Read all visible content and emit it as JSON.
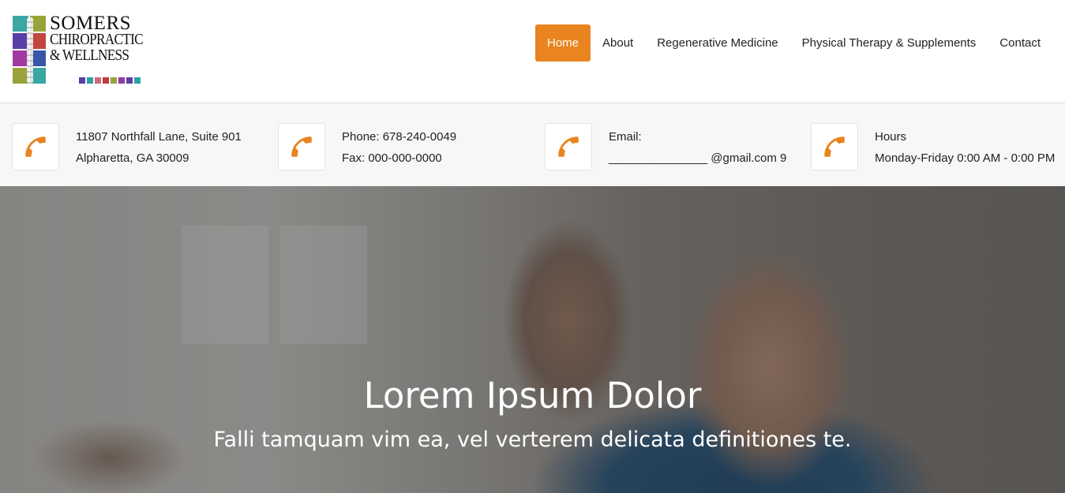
{
  "logo": {
    "line1": "SOMERS",
    "line2": "CHIROPRACTIC",
    "line3": "& WELLNESS",
    "colors": [
      "#3aa7a2",
      "#9aa33a",
      "#5a3ea8",
      "#c2453e",
      "#a33aa1",
      "#3a55a8",
      "#9aa33a",
      "#3aa7a2"
    ],
    "dot_colors": [
      "#5b3fa6",
      "#2f9fa3",
      "#d06a7a",
      "#c03a44",
      "#9aa33a",
      "#8e3aa3",
      "#5b3fa6",
      "#2f9fa3"
    ]
  },
  "nav": {
    "items": [
      {
        "label": "Home",
        "active": true
      },
      {
        "label": "About",
        "active": false
      },
      {
        "label": "Regenerative Medicine",
        "active": false
      },
      {
        "label": "Physical Therapy & Supplements",
        "active": false
      },
      {
        "label": "Contact",
        "active": false
      }
    ]
  },
  "info": [
    {
      "icon": "phone-icon",
      "line1": "11807 Northfall Lane, Suite 901",
      "line2": "Alpharetta, GA 30009"
    },
    {
      "icon": "phone-icon",
      "line1": "Phone: 678-240-0049",
      "line2": "Fax: 000-000-0000"
    },
    {
      "icon": "phone-icon",
      "line1": "Email:",
      "line2": "_______________ @gmail.com 9"
    },
    {
      "icon": "phone-icon",
      "line1": "Hours",
      "line2": "Monday-Friday 0:00 AM - 0:00 PM"
    }
  ],
  "hero": {
    "title": "Lorem Ipsum Dolor",
    "subtitle": "Falli tamquam vim ea, vel verterem delicata definitiones te."
  },
  "colors": {
    "accent": "#e98420",
    "info_bg": "#f7f7f7"
  }
}
